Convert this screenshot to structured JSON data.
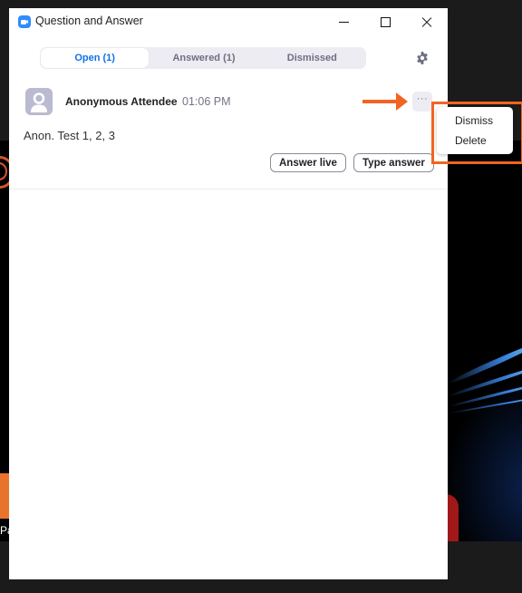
{
  "window": {
    "title": "Question and Answer",
    "controls": {
      "minimize": "minimize-icon",
      "maximize": "maximize-icon",
      "close": "close-icon"
    }
  },
  "tabs": [
    {
      "label": "Open (1)",
      "active": true
    },
    {
      "label": "Answered (1)",
      "active": false
    },
    {
      "label": "Dismissed",
      "active": false
    }
  ],
  "settings_icon": "gear-icon",
  "question": {
    "author": "Anonymous Attendee",
    "time": "01:06 PM",
    "text": "Anon. Test 1, 2, 3",
    "more_label": "···",
    "actions": {
      "answer_live": "Answer live",
      "type_answer": "Type answer"
    }
  },
  "more_menu": {
    "items": [
      "Dismiss",
      "Delete"
    ]
  },
  "background": {
    "partial_label": "Pa"
  },
  "colors": {
    "accent": "#0e71eb",
    "annotation": "#f26422",
    "tab_bg": "#ececf2",
    "avatar_bg": "#babad0"
  }
}
